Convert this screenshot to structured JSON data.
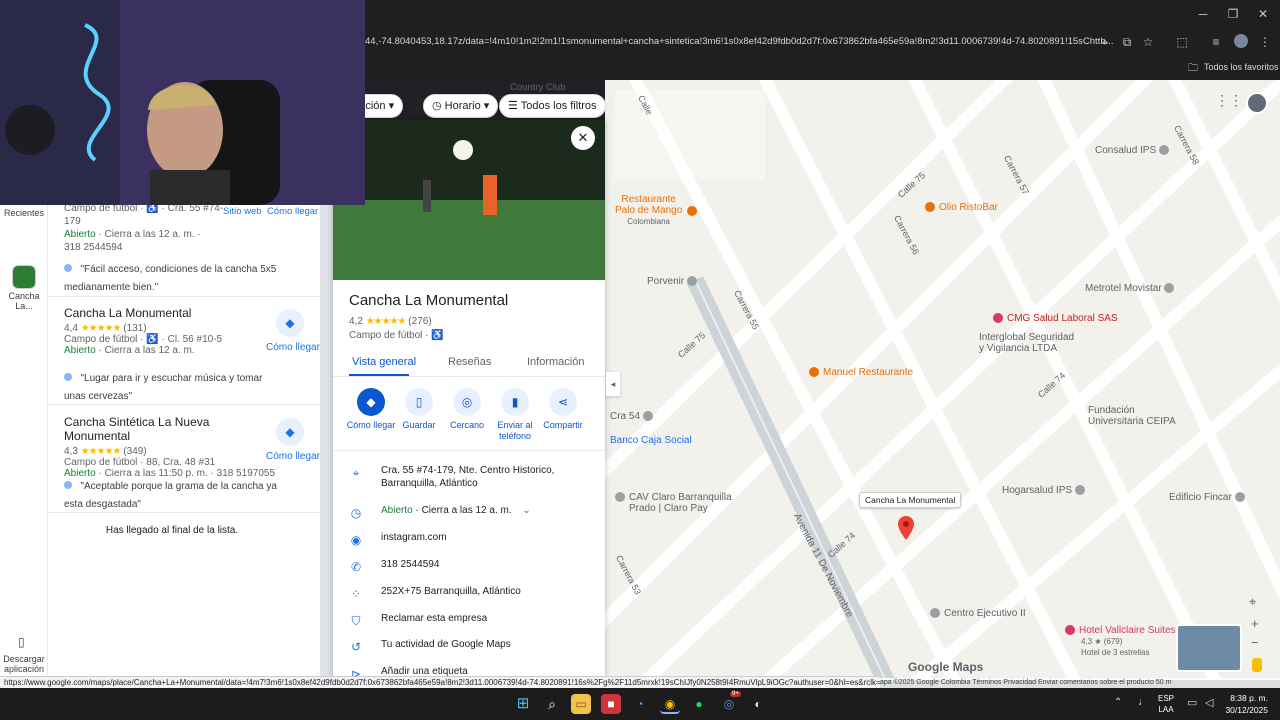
{
  "browser": {
    "url": "44,-74.8040453,18.17z/data=!4m10!1m2!2m1!1smonumental+cancha+sintetica!3m6!1s0x8ef42d9fdb0d2d7f:0x673862bfa465e59a!8m2!3d11.0006739!4d-74.8020891!15sChttb...",
    "bookmarks_label": "Todos los favoritos",
    "status_url": "https://www.google.com/maps/place/Cancha+La+Monumental/data=!4m7!3m6!1s0x8ef42d9fdb0d2d7f:0x673862bfa465e59a!8m2!3d11.0006739!4d-74.8020891!16s%2Fg%2F11d5mrxk!19sChIJfy0N258t9I4RmuVlpL9iOGc?authuser=0&hl=es&rclk=1"
  },
  "rail": {
    "recientes": "Recientes",
    "cancha_item": "Cancha La...",
    "descargar": "Descargar aplicación"
  },
  "filters": {
    "valoracion": "loración",
    "horario": "Horario",
    "todos": "Todos los filtros",
    "country_club": "Country Club"
  },
  "results": {
    "item0": {
      "category_line": "Campo de fútbol · ♿ · Cra. 55 #74-",
      "address_cont": "179",
      "hours_status": "Abierto",
      "hours_rest": " · Cierra a las 12 a. m. ·",
      "phone": "318 2544594",
      "quote": "\"Fácil acceso, condiciones de la cancha 5x5 medianamente bien.\"",
      "sitio_web": "Sitio web",
      "como_llegar": "Cómo llegar"
    },
    "item1": {
      "title": "Cancha La Monumental",
      "rating": "4,4",
      "stars": "★★★★★",
      "reviews": "(131)",
      "category_line": "Campo de fútbol · ♿ · Cl. 56 #10-5",
      "hours_status": "Abierto",
      "hours_rest": " · Cierra a las 12 a. m.",
      "quote": "\"Lugar para ir y escuchar música y tomar unas cervezas\"",
      "como_llegar": "Cómo llegar"
    },
    "item2": {
      "title": "Cancha Sintética La Nueva Monumental",
      "rating": "4,3",
      "stars": "★★★★★",
      "reviews": "(349)",
      "category_line": "Campo de fútbol · 88, Cra. 48 #31",
      "hours_status": "Abierto",
      "hours_rest": " · Cierra a las 11:50 p. m. · 318 5197055",
      "quote": "\"Aceptable porque la grama de la cancha ya esta desgastada\"",
      "como_llegar": "Cómo llegar"
    },
    "end_of_list": "Has llegado al final de la lista."
  },
  "detail": {
    "title": "Cancha La Monumental",
    "rating": "4,2",
    "stars": "★★★★★",
    "reviews": "(276)",
    "category": "Campo de fútbol · ♿",
    "tabs": [
      "Vista general",
      "Reseñas",
      "Información"
    ],
    "actions": [
      "Cómo llegar",
      "Guardar",
      "Cercano",
      "Enviar al teléfono",
      "Compartir"
    ],
    "address": "Cra. 55 #74-179, Nte. Centro Historico, Barranquilla, Atlántico",
    "hours_status": "Abierto",
    "hours_rest": " · Cierra a las 12 a. m.",
    "website": "instagram.com",
    "phone": "318 2544594",
    "plus_code": "252X+75 Barranquilla, Atlántico",
    "claim": "Reclamar esta empresa",
    "activity": "Tu actividad de Google Maps",
    "add_label": "Añadir una etiqueta"
  },
  "map": {
    "places": {
      "restaurante_palo": "Restaurante",
      "restaurante_palo2": "Palo de Mango",
      "restaurante_palo3": "Colombiana",
      "olio": "Olio RistoBar",
      "consalud": "Consalud IPS",
      "porvenir": "Porvenir",
      "metrotel": "Metrotel Movistar",
      "cmg": "CMG Salud Laboral SAS",
      "interglobal": "Interglobal Seguridad",
      "interglobal2": "y Vigilancia LTDA",
      "manuel": "Manuel Restaurante",
      "fundacion": "Fundación",
      "fundacion2": "Universitaria CEIPA",
      "cra54": "Cra 54",
      "banco": "Banco Caja Social",
      "cav": "CAV Claro Barranquilla",
      "cav2": "Prado | Claro Pay",
      "hogarsalud": "Hogarsalud IPS",
      "fincar": "Edificio Fincar",
      "cancha": "Cancha La Monumental",
      "centro": "Centro Ejecutivo II",
      "hotel": "Hotel Vallclaire Suites",
      "hotel_rating": "4,3 ★ (679)",
      "hotel_class": "Hotel de 3 estrellas"
    },
    "streets": {
      "calle": "Calle",
      "carrera55": "Carrera 55",
      "carrera56": "Carrera 56",
      "carrera57": "Carrera 57",
      "carrera58": "Carrera 58",
      "carrera53": "Carrera 53",
      "calle75": "Calle 75",
      "calle74": "Calle 74",
      "avenida": "Avenida 11 De Noviembre"
    },
    "brand": "Google Maps",
    "footer": "apa ©2025 Google   Colombia   Términos   Privacidad   Enviar comentarios sobre el producto   50 m"
  },
  "taskbar": {
    "lang1": "ESP",
    "lang2": "LAA",
    "time": "8:38 p. m.",
    "date": "30/12/2025",
    "badge": "9+"
  }
}
